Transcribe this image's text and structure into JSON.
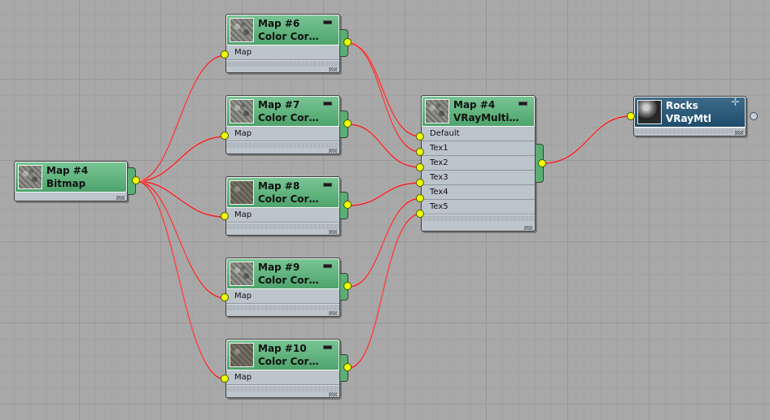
{
  "nodes": {
    "bitmap": {
      "name": "Map #4",
      "type": "Bitmap"
    },
    "cc6": {
      "name": "Map #6",
      "type": "Color Cor…",
      "slots": [
        "Map"
      ]
    },
    "cc7": {
      "name": "Map #7",
      "type": "Color Cor…",
      "slots": [
        "Map"
      ]
    },
    "cc8": {
      "name": "Map #8",
      "type": "Color Cor…",
      "slots": [
        "Map"
      ]
    },
    "cc9": {
      "name": "Map #9",
      "type": "Color Cor…",
      "slots": [
        "Map"
      ]
    },
    "cc10": {
      "name": "Map #10",
      "type": "Color Cor…",
      "slots": [
        "Map"
      ]
    },
    "multi": {
      "name": "Map #4",
      "type": "VRayMulti…",
      "slots": [
        "Default",
        "Tex1",
        "Tex2",
        "Tex3",
        "Tex4",
        "Tex5"
      ]
    },
    "mtl": {
      "name": "Rocks",
      "type": "VRayMtl"
    }
  },
  "colors": {
    "wire": "#ee1c1c",
    "port": "#eeff00",
    "map_header": "#5fb27c",
    "material_header": "#2b5878",
    "canvas": "#a8a8a8"
  },
  "icons": {
    "thumbnail": "texture-thumbnail-icon",
    "material_preview": "material-sphere-icon",
    "minimize": "minimize-icon"
  }
}
